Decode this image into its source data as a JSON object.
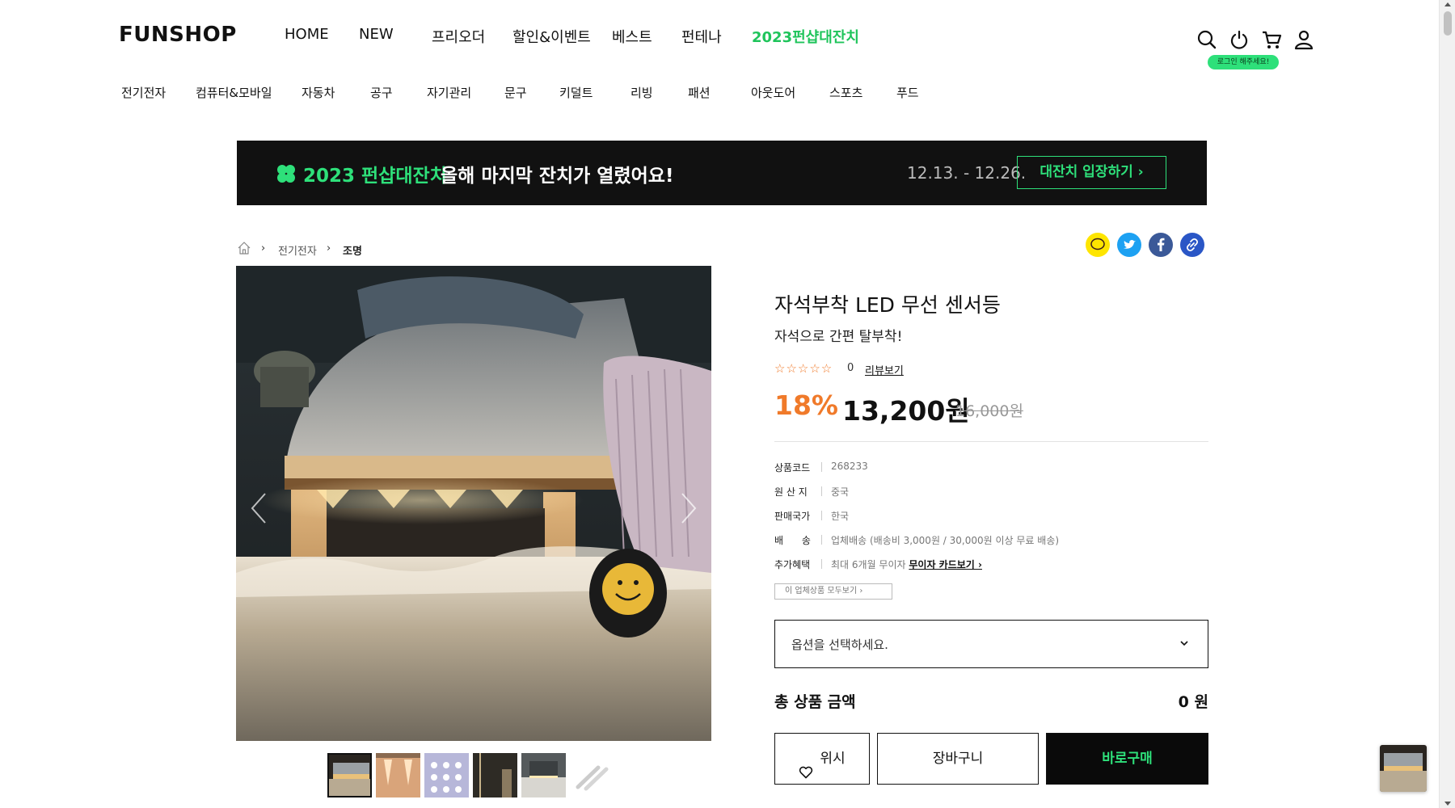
{
  "header": {
    "logo": "FUNSHOP",
    "nav": [
      "HOME",
      "NEW",
      "프리오더",
      "할인&이벤트",
      "베스트",
      "펀테나",
      "2023펀샵대잔치"
    ],
    "util_icons": [
      "search-icon",
      "power-icon",
      "cart-icon",
      "user-icon"
    ],
    "login_badge": "로그인 해주세요!",
    "accent": "#2ee07a"
  },
  "categories": [
    "전기전자",
    "컴퓨터&모바일",
    "자동차",
    "공구",
    "자기관리",
    "문구",
    "키덜트",
    "리빙",
    "패션",
    "아웃도어",
    "스포츠",
    "푸드"
  ],
  "banner": {
    "highlight": "2023 펀샵대잔치",
    "message": "올해 마지막 잔치가 열렸어요!",
    "dates": "12.13. - 12.26.",
    "cta": "대잔치 입장하기 ›"
  },
  "breadcrumb": {
    "level1": "전기전자",
    "level2": "조명"
  },
  "share": [
    "kakaotalk-icon",
    "twitter-icon",
    "facebook-icon",
    "link-icon"
  ],
  "product": {
    "title": "자석부착 LED 무선 센서등",
    "subtitle": "자석으로 간편 탈부착!",
    "stars": "☆☆☆☆☆",
    "rating_value": 0,
    "review_count": "0",
    "review_link": "리뷰보기",
    "discount": "18%",
    "sale_price": "13,200원",
    "original_price": "16,000원",
    "specs": [
      {
        "key": "상품코드",
        "value": "268233"
      },
      {
        "key": "원 산 지",
        "value": "중국"
      },
      {
        "key": "판매국가",
        "value": "한국"
      },
      {
        "key": "배      송",
        "value": "업체배송 (배송비 3,000원 / 30,000원 이상 무료 배송)"
      },
      {
        "key": "추가혜택",
        "value": "최대 6개월 무이자",
        "link": "무이자 카드보기 ›"
      }
    ],
    "vendor_button": "이 업체상품 모두보기 ›",
    "option_placeholder": "옵션을 선택하세요.",
    "total_label": "총 상품 금액",
    "total_value": "0 원",
    "wish_button": "위시",
    "cart_button": "장바구니",
    "buy_button": "바로구매"
  },
  "thumbnails": [
    "thumb-1",
    "thumb-2",
    "thumb-3",
    "thumb-4",
    "thumb-5",
    "thumb-6"
  ]
}
